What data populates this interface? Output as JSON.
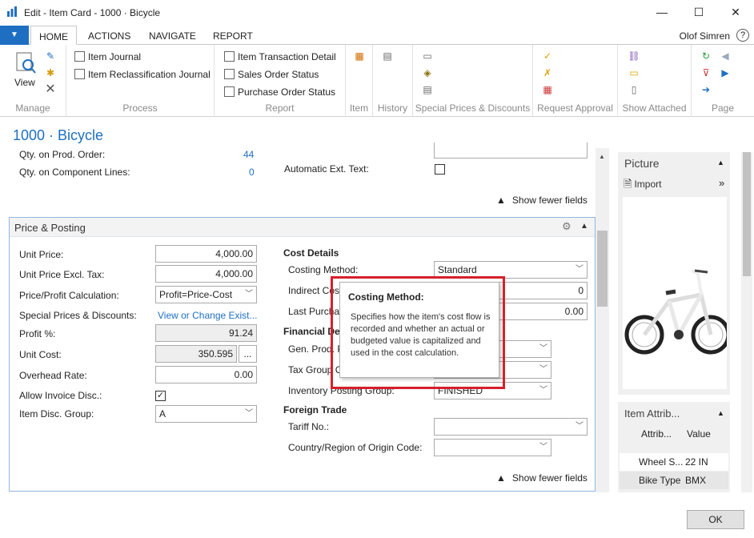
{
  "window": {
    "title": "Edit - Item Card - 1000 · Bicycle",
    "minimize": "—",
    "maximize": "☐",
    "close": "✕"
  },
  "ribbon_tabs": [
    {
      "label": "HOME",
      "active": true
    },
    {
      "label": "ACTIONS"
    },
    {
      "label": "NAVIGATE"
    },
    {
      "label": "REPORT"
    }
  ],
  "user": "Olof Simren",
  "help": "?",
  "app_button_icon": "▼",
  "ribbon": {
    "manage": {
      "label": "Manage",
      "view": "View"
    },
    "process": {
      "label": "Process",
      "items": [
        "Item Journal",
        "Item Reclassification Journal"
      ]
    },
    "report": {
      "label": "Report",
      "items": [
        "Item Transaction Detail",
        "Sales Order Status",
        "Purchase Order Status"
      ]
    },
    "groups": [
      "Item",
      "History",
      "Special Prices & Discounts",
      "Request Approval",
      "Show Attached",
      "Page"
    ]
  },
  "page_title": "1000 · Bicycle",
  "top_section": {
    "qty_prod_order_label": "Qty. on Prod. Order:",
    "qty_prod_order_value": "44",
    "qty_component_label": "Qty. on Component Lines:",
    "qty_component_value": "0",
    "auto_ext_text_label": "Automatic Ext. Text:",
    "show_fewer": "Show fewer fields"
  },
  "price_posting": {
    "title": "Price & Posting",
    "unit_price_label": "Unit Price:",
    "unit_price": "4,000.00",
    "unit_price_excl_label": "Unit Price Excl. Tax:",
    "unit_price_excl": "4,000.00",
    "ppc_label": "Price/Profit Calculation:",
    "ppc_value": "Profit=Price-Cost",
    "special_prices_label": "Special Prices & Discounts:",
    "special_prices_link": "View or Change Exist...",
    "profit_label": "Profit %:",
    "profit_value": "91.24",
    "unit_cost_label": "Unit Cost:",
    "unit_cost_value": "350.595",
    "assist_btn": "...",
    "overhead_label": "Overhead Rate:",
    "overhead_value": "0.00",
    "allow_inv_disc_label": "Allow Invoice Disc.:",
    "allow_inv_disc_checked": "✓",
    "item_disc_group_label": "Item Disc. Group:",
    "item_disc_group_value": "A",
    "cost_details": "Cost Details",
    "costing_method_label": "Costing Method:",
    "costing_method_value": "Standard",
    "indirect_cost_label": "Indirect Cos",
    "indirect_cost_value": "0",
    "last_purchase_label": "Last Purchas",
    "last_purchase_value": "0.00",
    "financial_details": "Financial Det",
    "gen_prod_label": "Gen. Prod. P",
    "tax_group_label": "Tax Group C",
    "inventory_posting_label": "Inventory Posting Group:",
    "inventory_posting_value": "FINISHED",
    "foreign_trade": "Foreign Trade",
    "tariff_label": "Tariff No.:",
    "country_label": "Country/Region of Origin Code:",
    "show_fewer": "Show fewer fields"
  },
  "tooltip": {
    "title": "Costing Method:",
    "body": "Specifies how the item's cost flow is recorded and whether an actual or budgeted value is capitalized and used in the cost calculation."
  },
  "factbox_picture": {
    "title": "Picture",
    "import": "Import"
  },
  "factbox_attributes": {
    "title": "Item Attrib...",
    "col_attribute": "Attrib...",
    "col_value": "Value",
    "rows": [
      {
        "attribute": "Wheel S...",
        "value": "22 IN"
      },
      {
        "attribute": "Bike Type",
        "value": "BMX"
      }
    ]
  },
  "ok_button": "OK",
  "colors": {
    "accent": "#1e6fc2",
    "tooltip_border": "#d6202c"
  }
}
